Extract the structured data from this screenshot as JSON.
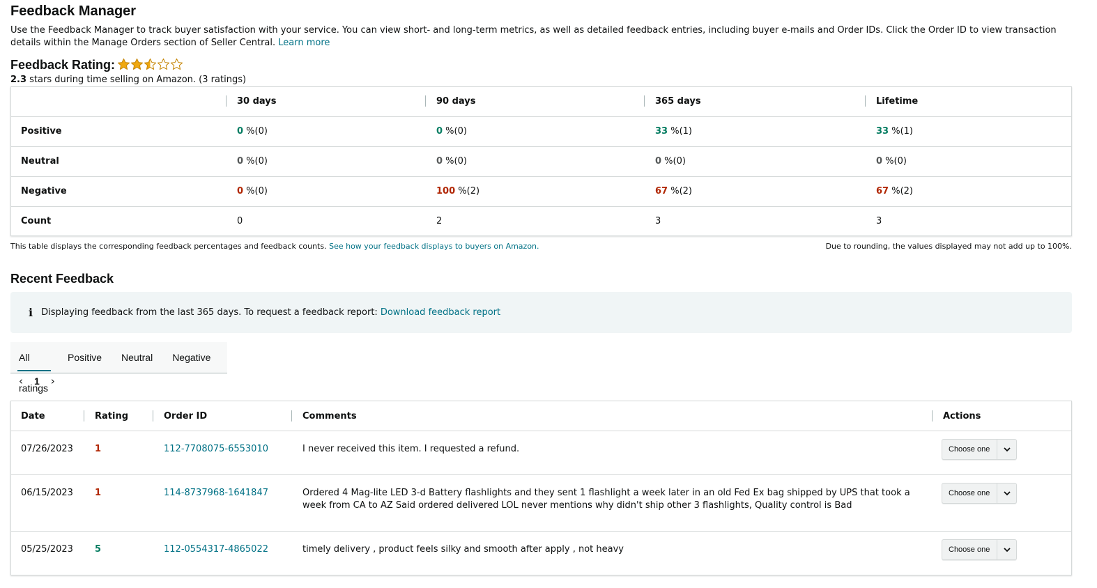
{
  "header": {
    "title": "Feedback Manager",
    "intro": "Use the Feedback Manager to track buyer satisfaction with your service. You can view short- and long-term metrics, as well as detailed feedback entries, including buyer e-mails and Order IDs. Click the Order ID to view transaction details within the Manage Orders section of Seller Central.",
    "learn_more": "Learn more"
  },
  "rating": {
    "label": "Feedback Rating:",
    "stars_value": 2.3,
    "stars_max": 5,
    "summary_value": "2.3",
    "summary_mid": " stars during time selling on Amazon. (",
    "summary_count": "3",
    "summary_end": " ratings)"
  },
  "metrics": {
    "columns": [
      "30 days",
      "90 days",
      "365 days",
      "Lifetime"
    ],
    "rows": [
      {
        "label": "Positive",
        "cells": [
          {
            "pct": "0",
            "rest": " %(0)"
          },
          {
            "pct": "0",
            "rest": " %(0)"
          },
          {
            "pct": "33",
            "rest": " %(1)"
          },
          {
            "pct": "33",
            "rest": " %(1)"
          }
        ]
      },
      {
        "label": "Neutral",
        "cells": [
          {
            "pct": "0",
            "rest": " %(0)"
          },
          {
            "pct": "0",
            "rest": " %(0)"
          },
          {
            "pct": "0",
            "rest": " %(0)"
          },
          {
            "pct": "0",
            "rest": " %(0)"
          }
        ]
      },
      {
        "label": "Negative",
        "cells": [
          {
            "pct": "0",
            "rest": " %(0)"
          },
          {
            "pct": "100",
            "rest": " %(2)"
          },
          {
            "pct": "67",
            "rest": " %(2)"
          },
          {
            "pct": "67",
            "rest": " %(2)"
          }
        ]
      },
      {
        "label": "Count",
        "cells": [
          {
            "pct": "0",
            "rest": ""
          },
          {
            "pct": "2",
            "rest": ""
          },
          {
            "pct": "3",
            "rest": ""
          },
          {
            "pct": "3",
            "rest": ""
          }
        ]
      }
    ],
    "note_left": "This table displays the corresponding feedback percentages and feedback counts.",
    "note_link": "See how your feedback displays to buyers on Amazon.",
    "note_right": "Due to rounding, the values displayed may not add up to 100%."
  },
  "recent": {
    "title": "Recent Feedback",
    "info_icon": "i",
    "info_text": "Displaying feedback from the last 365 days. To request a feedback report:",
    "info_link": "Download feedback report",
    "tabs": [
      "All ratings",
      "Positive",
      "Neutral",
      "Negative"
    ],
    "active_tab": "All ratings",
    "pager": {
      "prev": "‹",
      "page": "1",
      "next": "›"
    },
    "columns": {
      "date": "Date",
      "rating": "Rating",
      "order_id": "Order ID",
      "comments": "Comments",
      "actions": "Actions"
    },
    "rows": [
      {
        "date": "07/26/2023",
        "rating": "1",
        "order_id": "112-7708075-6553010",
        "comment": "I never received this item. I requested a refund.",
        "action": "Choose one"
      },
      {
        "date": "06/15/2023",
        "rating": "1",
        "order_id": "114-8737968-1641847",
        "comment": "Ordered 4 Mag-lite LED 3-d Battery flashlights and they sent 1 flashlight a week later in an old Fed Ex bag shipped by UPS that took a week from CA to AZ Said ordered delivered LOL never mentions why didn't ship other 3 flashlights, Quality control is Bad",
        "action": "Choose one"
      },
      {
        "date": "05/25/2023",
        "rating": "5",
        "order_id": "112-0554317-4865022",
        "comment": "timely delivery , product feels silky and smooth after apply , not heavy",
        "action": "Choose one"
      }
    ]
  },
  "colors": {
    "positive": "#067d62",
    "negative": "#b12704",
    "neutral": "#565959",
    "link": "#007185",
    "star": "#f0a80e",
    "info_bg": "#f0f5f6"
  }
}
